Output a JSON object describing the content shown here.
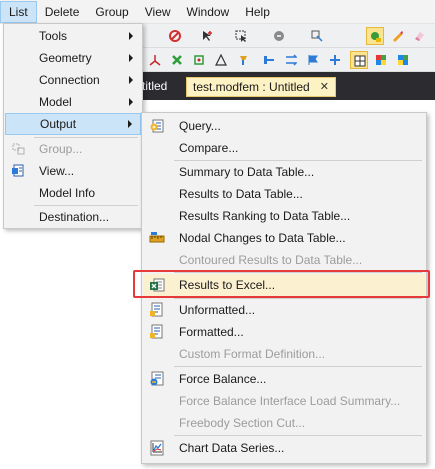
{
  "menubar": {
    "items": [
      "List",
      "Delete",
      "Group",
      "View",
      "Window",
      "Help"
    ]
  },
  "tabs": {
    "left_label": "titled",
    "active_label": "test.modfem : Untitled",
    "close_glyph": "✕"
  },
  "list_menu": {
    "items": [
      {
        "label": "Tools",
        "submenu": true
      },
      {
        "label": "Geometry",
        "submenu": true
      },
      {
        "label": "Connection",
        "submenu": true
      },
      {
        "label": "Model",
        "submenu": true
      },
      {
        "label": "Output",
        "submenu": true,
        "highlighted": true
      },
      {
        "label": "Group...",
        "disabled": true
      },
      {
        "label": "View..."
      },
      {
        "label": "Model Info"
      },
      {
        "label": "Destination..."
      }
    ]
  },
  "output_menu": {
    "items": [
      {
        "label": "Query...",
        "icon": "query-icon"
      },
      {
        "label": "Compare..."
      },
      {
        "label": "Summary to Data Table..."
      },
      {
        "label": "Results to Data Table..."
      },
      {
        "label": "Results Ranking to Data Table..."
      },
      {
        "label": "Nodal Changes to Data Table...",
        "icon": "ruler-icon"
      },
      {
        "label": "Contoured Results to Data Table...",
        "disabled": true
      },
      {
        "label": "Results to Excel...",
        "icon": "excel-icon",
        "emphasized": true
      },
      {
        "label": "Unformatted...",
        "icon": "document-icon"
      },
      {
        "label": "Formatted...",
        "icon": "document-icon"
      },
      {
        "label": "Custom Format Definition...",
        "disabled": true
      },
      {
        "label": "Force Balance...",
        "icon": "force-balance-icon"
      },
      {
        "label": "Force Balance Interface Load Summary...",
        "disabled": true
      },
      {
        "label": "Freebody Section Cut...",
        "disabled": true
      },
      {
        "label": "Chart Data Series...",
        "icon": "chart-icon"
      }
    ]
  },
  "colors": {
    "highlight": "#cce4f7",
    "emphasis_border": "#e63a3a",
    "tab_strip": "#2b2b30",
    "active_tab": "#fdf2c4"
  }
}
